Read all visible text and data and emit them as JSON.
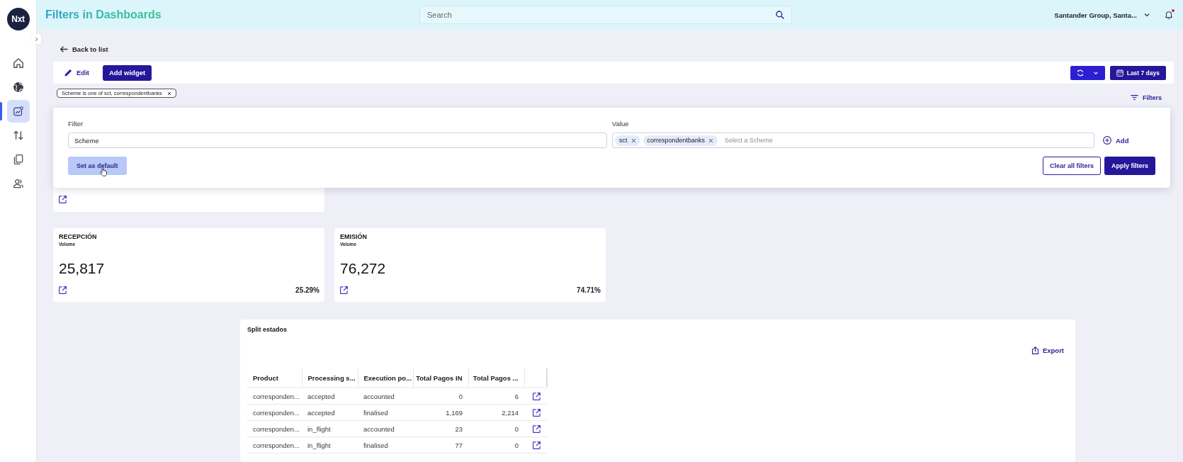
{
  "app": {
    "logo": "Nxt",
    "title": "Filters in Dashboards"
  },
  "sidebar": {
    "items": [
      {
        "selected": false
      },
      {
        "selected": false
      },
      {
        "selected": true
      },
      {
        "selected": false
      },
      {
        "selected": false
      },
      {
        "selected": false
      }
    ]
  },
  "search": {
    "placeholder": "Search"
  },
  "account": {
    "name": "Santander Group, Santa...",
    "unread": true
  },
  "back_link": "Back to list",
  "toolbar": {
    "edit": "Edit",
    "add_widget": "Add widget",
    "date_range": "Last 7 days"
  },
  "active_filters": [
    "Scheme is one of sct, correspondentbanks"
  ],
  "filters_button": "Filters",
  "filter_panel": {
    "filter_label": "Filter",
    "filter_value": "Scheme",
    "value_label": "Value",
    "values": [
      "sct",
      "correspondentbanks"
    ],
    "value_placeholder": "Select a Scheme",
    "add": "Add",
    "set_default": "Set as default",
    "clear_all": "Clear all filters",
    "apply": "Apply filters"
  },
  "kpi_cards": [
    {
      "title": "RECEPCIÓN",
      "subtitle": "Volume",
      "value": "25,817",
      "share": "25.29%"
    },
    {
      "title": "EMISIÓN",
      "subtitle": "Volume",
      "value": "76,272",
      "share": "74.71%"
    }
  ],
  "table_widget": {
    "title": "Split estados",
    "export": "Export",
    "columns": [
      "Product",
      "Processing s...",
      "Execution po...",
      "Total Pagos IN",
      "Total Pagos ..."
    ],
    "rows": [
      [
        "corresponden...",
        "accepted",
        "accounted",
        "0",
        "6"
      ],
      [
        "corresponden...",
        "accepted",
        "finalised",
        "1,169",
        "2,214"
      ],
      [
        "corresponden...",
        "in_flight",
        "accounted",
        "23",
        "0"
      ],
      [
        "corresponden...",
        "in_flight",
        "finalised",
        "77",
        "0"
      ]
    ]
  }
}
